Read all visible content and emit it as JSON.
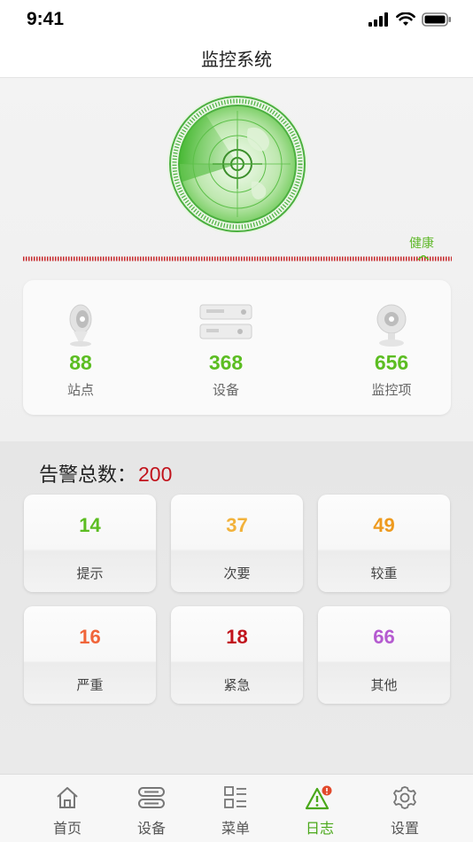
{
  "status_bar": {
    "time": "9:41"
  },
  "nav": {
    "title": "监控系统"
  },
  "health": {
    "label": "健康"
  },
  "stats": [
    {
      "value": "88",
      "label": "站点",
      "icon": "station-icon"
    },
    {
      "value": "368",
      "label": "设备",
      "icon": "device-icon"
    },
    {
      "value": "656",
      "label": "监控项",
      "icon": "monitor-item-icon"
    }
  ],
  "alarm": {
    "title": "告警总数：",
    "total": "200",
    "levels": [
      {
        "count": "14",
        "label": "提示",
        "color": "#5cbd22"
      },
      {
        "count": "37",
        "label": "次要",
        "color": "#f2b23b"
      },
      {
        "count": "49",
        "label": "较重",
        "color": "#ee9a1e"
      },
      {
        "count": "16",
        "label": "严重",
        "color": "#f0653a"
      },
      {
        "count": "18",
        "label": "紧急",
        "color": "#c1131c"
      },
      {
        "count": "66",
        "label": "其他",
        "color": "#b55bd0"
      }
    ]
  },
  "tabs": [
    {
      "label": "首页",
      "icon": "home-icon"
    },
    {
      "label": "设备",
      "icon": "device-tab-icon"
    },
    {
      "label": "菜单",
      "icon": "menu-icon"
    },
    {
      "label": "日志",
      "icon": "log-warning-icon",
      "active": true
    },
    {
      "label": "设置",
      "icon": "gear-icon"
    }
  ],
  "colors": {
    "accent_green": "#5cbd22",
    "alarm_red": "#c1131c"
  }
}
